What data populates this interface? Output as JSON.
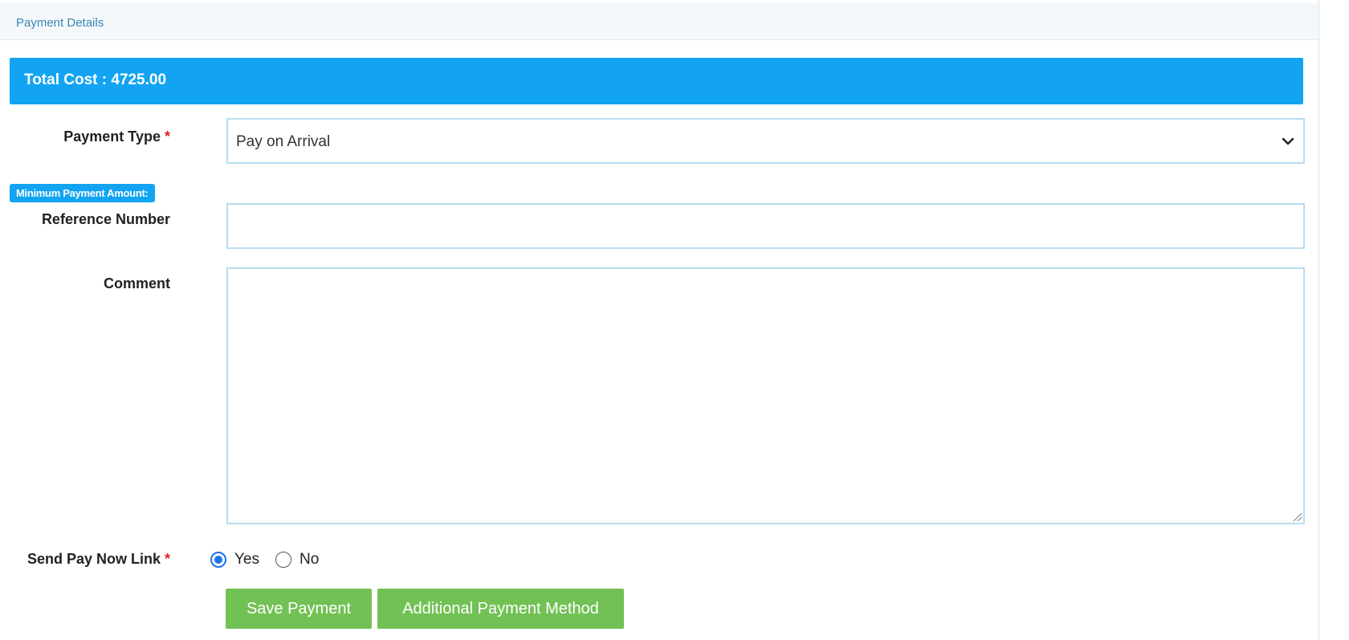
{
  "panel": {
    "title": "Payment Details"
  },
  "total": {
    "text": "Total Cost : 4725.00"
  },
  "payment_type": {
    "label": "Payment Type",
    "required_mark": "*",
    "selected": "Pay on Arrival",
    "icon": "chevron-down-icon"
  },
  "minimum_payment": {
    "badge": "Minimum Payment Amount:"
  },
  "reference_number": {
    "label": "Reference Number",
    "value": ""
  },
  "comment": {
    "label": "Comment",
    "value": ""
  },
  "send_pay_now_link": {
    "label": "Send Pay Now Link",
    "required_mark": "*",
    "options": [
      {
        "label": "Yes",
        "checked": true
      },
      {
        "label": "No",
        "checked": false
      }
    ]
  },
  "buttons": {
    "save": "Save Payment",
    "additional": "Additional Payment Method"
  },
  "colors": {
    "accent": "#12a4f2",
    "button": "#72c154",
    "required": "#e02424",
    "input_border": "#b8dcef",
    "radio_checked": "#1a73e8"
  }
}
